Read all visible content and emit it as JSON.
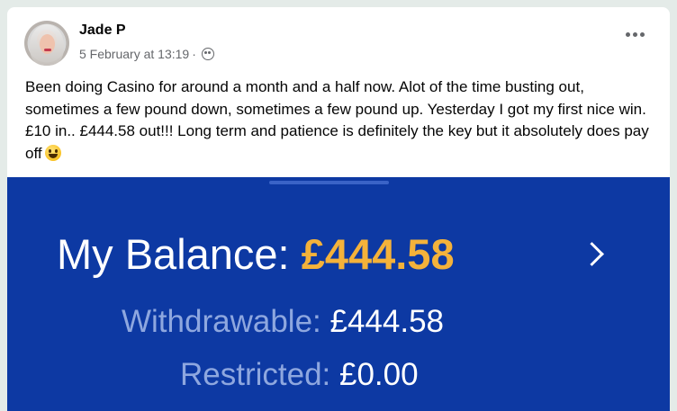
{
  "post": {
    "author": "Jade P",
    "date": "5 February at 13:19",
    "separator": "·",
    "audience_icon": "friends-icon",
    "more_icon": "more-options-icon",
    "text": "Been doing Casino for around a month and a half now. Alot of the time busting out, sometimes a few pound down, sometimes a few pound up. Yesterday I got my first nice win. £10 in.. £444.58 out!!! Long term and patience is definitely the key but it absolutely does pay off",
    "emoji": "grinning-face-emoji"
  },
  "photo": {
    "balance_label": "My Balance: ",
    "balance_amount": "£444.58",
    "withdrawable_label": "Withdrawable: ",
    "withdrawable_amount": "£444.58",
    "restricted_label": "Restricted: ",
    "restricted_amount": "£0.00",
    "chevron_icon": "chevron-right-icon"
  },
  "colors": {
    "page_background": "#e4ebe8",
    "photo_background": "#0d39a3",
    "balance_accent": "#f4b23a",
    "muted_label": "#8ea7df"
  }
}
